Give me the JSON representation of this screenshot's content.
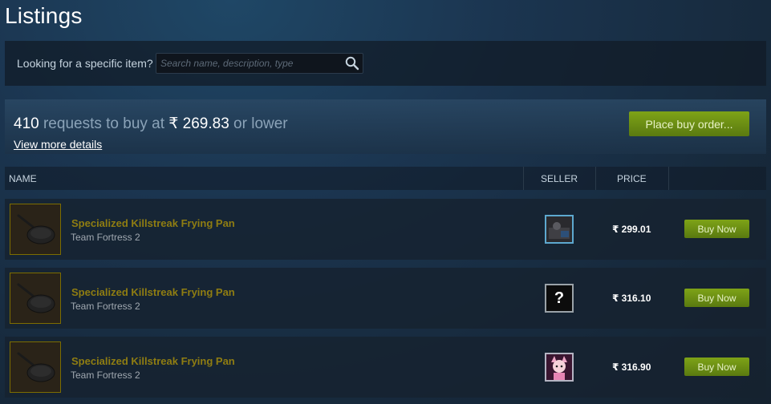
{
  "page": {
    "title": "Listings"
  },
  "search": {
    "label": "Looking for a specific item?",
    "placeholder": "Search name, description, type",
    "value": ""
  },
  "buy_order": {
    "count": "410",
    "mid_text": " requests to buy at ",
    "price": "₹ 269.83",
    "suffix": " or lower",
    "details_link": "View more details",
    "button_label": "Place buy order..."
  },
  "table": {
    "columns": {
      "name": "NAME",
      "seller": "SELLER",
      "price": "PRICE"
    },
    "rows": [
      {
        "item": "Specialized Killstreak Frying Pan",
        "game": "Team Fortress 2",
        "seller_avatar": "dark-photo-avatar",
        "price": "₹ 299.01",
        "action": "Buy Now"
      },
      {
        "item": "Specialized Killstreak Frying Pan",
        "game": "Team Fortress 2",
        "seller_avatar": "?",
        "price": "₹ 316.10",
        "action": "Buy Now"
      },
      {
        "item": "Specialized Killstreak Frying Pan",
        "game": "Team Fortress 2",
        "seller_avatar": "anime-girl-avatar",
        "price": "₹ 316.90",
        "action": "Buy Now"
      }
    ]
  },
  "colors": {
    "accent_green": "#7ea317",
    "item_name_gold": "#8f7d12",
    "background": "#1b3550"
  }
}
